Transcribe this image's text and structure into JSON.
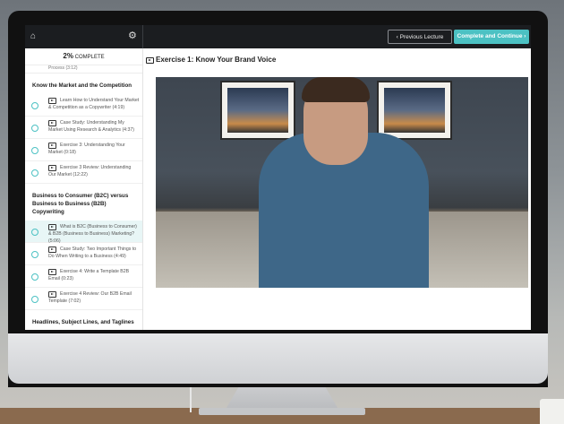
{
  "topbar": {
    "prev_label": "Previous Lecture",
    "next_label": "Complete and Continue"
  },
  "sidebar": {
    "progress_pct": "2%",
    "progress_label": "COMPLETE",
    "cut_item": "Process (3:12)",
    "sections": [
      {
        "title": "Know the Market and the Competition",
        "items": [
          {
            "label": "Learn How to Understand Your Market & Competition as a Copywriter (4:19)"
          },
          {
            "label": "Case Study: Understanding My Market Using Research & Analytics (4:37)"
          },
          {
            "label": "Exercise 3: Understanding Your Market (0:18)"
          },
          {
            "label": "Exercise 3 Review: Understanding Our Market (12:22)"
          }
        ]
      },
      {
        "title": "Business to Consumer (B2C) versus Business to Business (B2B) Copywriting",
        "items": [
          {
            "label": "What is B2C (Business to Consumer) & B2B (Business to Business) Marketing? (5:06)"
          },
          {
            "label": "Case Study: Two Important Things to Do When Writing to a Business (4:49)"
          },
          {
            "label": "Exercise 4: Write a Template B2B Email (0:23)"
          },
          {
            "label": "Exercise 4 Review: Our B2B Email Template (7:02)"
          }
        ]
      },
      {
        "title": "Headlines, Subject Lines, and Taglines",
        "items": []
      }
    ]
  },
  "content": {
    "title": "Exercise 1: Know Your Brand Voice"
  }
}
